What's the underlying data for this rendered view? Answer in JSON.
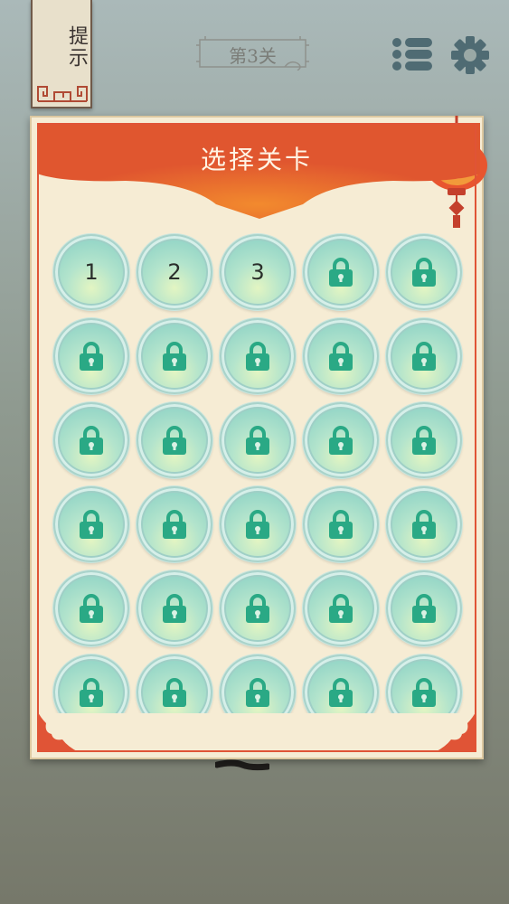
{
  "hint": {
    "label": "提示"
  },
  "header": {
    "level_label": "第3关",
    "list_icon": "list-icon",
    "settings_icon": "gear-icon"
  },
  "dialog": {
    "title": "选择关卡",
    "close_icon": "close-icon",
    "unlocked": [
      "1",
      "2",
      "3"
    ],
    "locked_icon": "lock-icon",
    "visible_button_count": 30
  },
  "colors": {
    "accent": "#e05436",
    "banner": "#e0562f",
    "button_teal": "#82cdc4",
    "lock": "#2aa985",
    "paper": "#f6ecd4"
  }
}
